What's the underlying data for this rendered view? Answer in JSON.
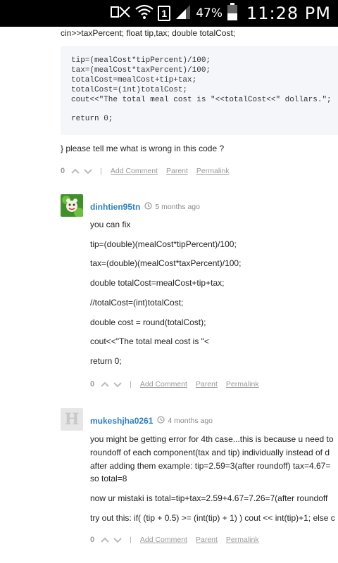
{
  "status_bar": {
    "battery_percent": "47%",
    "time": "11:28 PM",
    "sim_label": "1",
    "battery_level": 0.47
  },
  "question": {
    "top_line": "cin>>taxPercent; float tip,tax; double totalCost;",
    "code_lines": [
      "tip=(mealCost*tipPercent)/100;",
      "tax=(mealCost*taxPercent)/100;",
      "totalCost=mealCost+tip+tax;",
      "totalCost=(int)totalCost;",
      "cout<<\"The total meal cost is \"<<totalCost<<\" dollars.\";",
      "",
      "return 0;"
    ],
    "closing_text": "} please tell me what is wrong in this code ?",
    "votes": "0",
    "add_comment": "Add Comment",
    "parent": "Parent",
    "permalink": "Permalink"
  },
  "reply1": {
    "author": "dinhtien95tn",
    "time": "5 months ago",
    "lines": [
      "you can fix",
      "tip=(double)(mealCost*tipPercent)/100;",
      "tax=(double)(mealCost*taxPercent)/100;",
      "double totalCost=mealCost+tip+tax;",
      "//totalCost=(int)totalCost;",
      "double cost = round(totalCost);",
      "cout<<\"The total meal cost is \"<",
      "return 0;"
    ],
    "votes": "0",
    "add_comment": "Add Comment",
    "parent": "Parent",
    "permalink": "Permalink"
  },
  "reply2": {
    "author": "mukeshjha0261",
    "time": "4 months ago",
    "avatar_letter": "H",
    "lines": [
      "you might be getting error for 4th case...this is because u need to",
      "roundoff of each component(tax and tip) individually instead of d",
      "after adding them example: tip=2.59=3(after roundoff) tax=4.67=",
      "so total=8",
      "now ur mistaki is total=tip+tax=2.59+4.67=7.26=7(after roundoff",
      "try out this: if( (tip + 0.5) >= (int(tip) + 1) ) cout << int(tip)+1; else c"
    ],
    "votes": "0",
    "add_comment": "Add Comment",
    "parent": "Parent",
    "permalink": "Permalink"
  }
}
